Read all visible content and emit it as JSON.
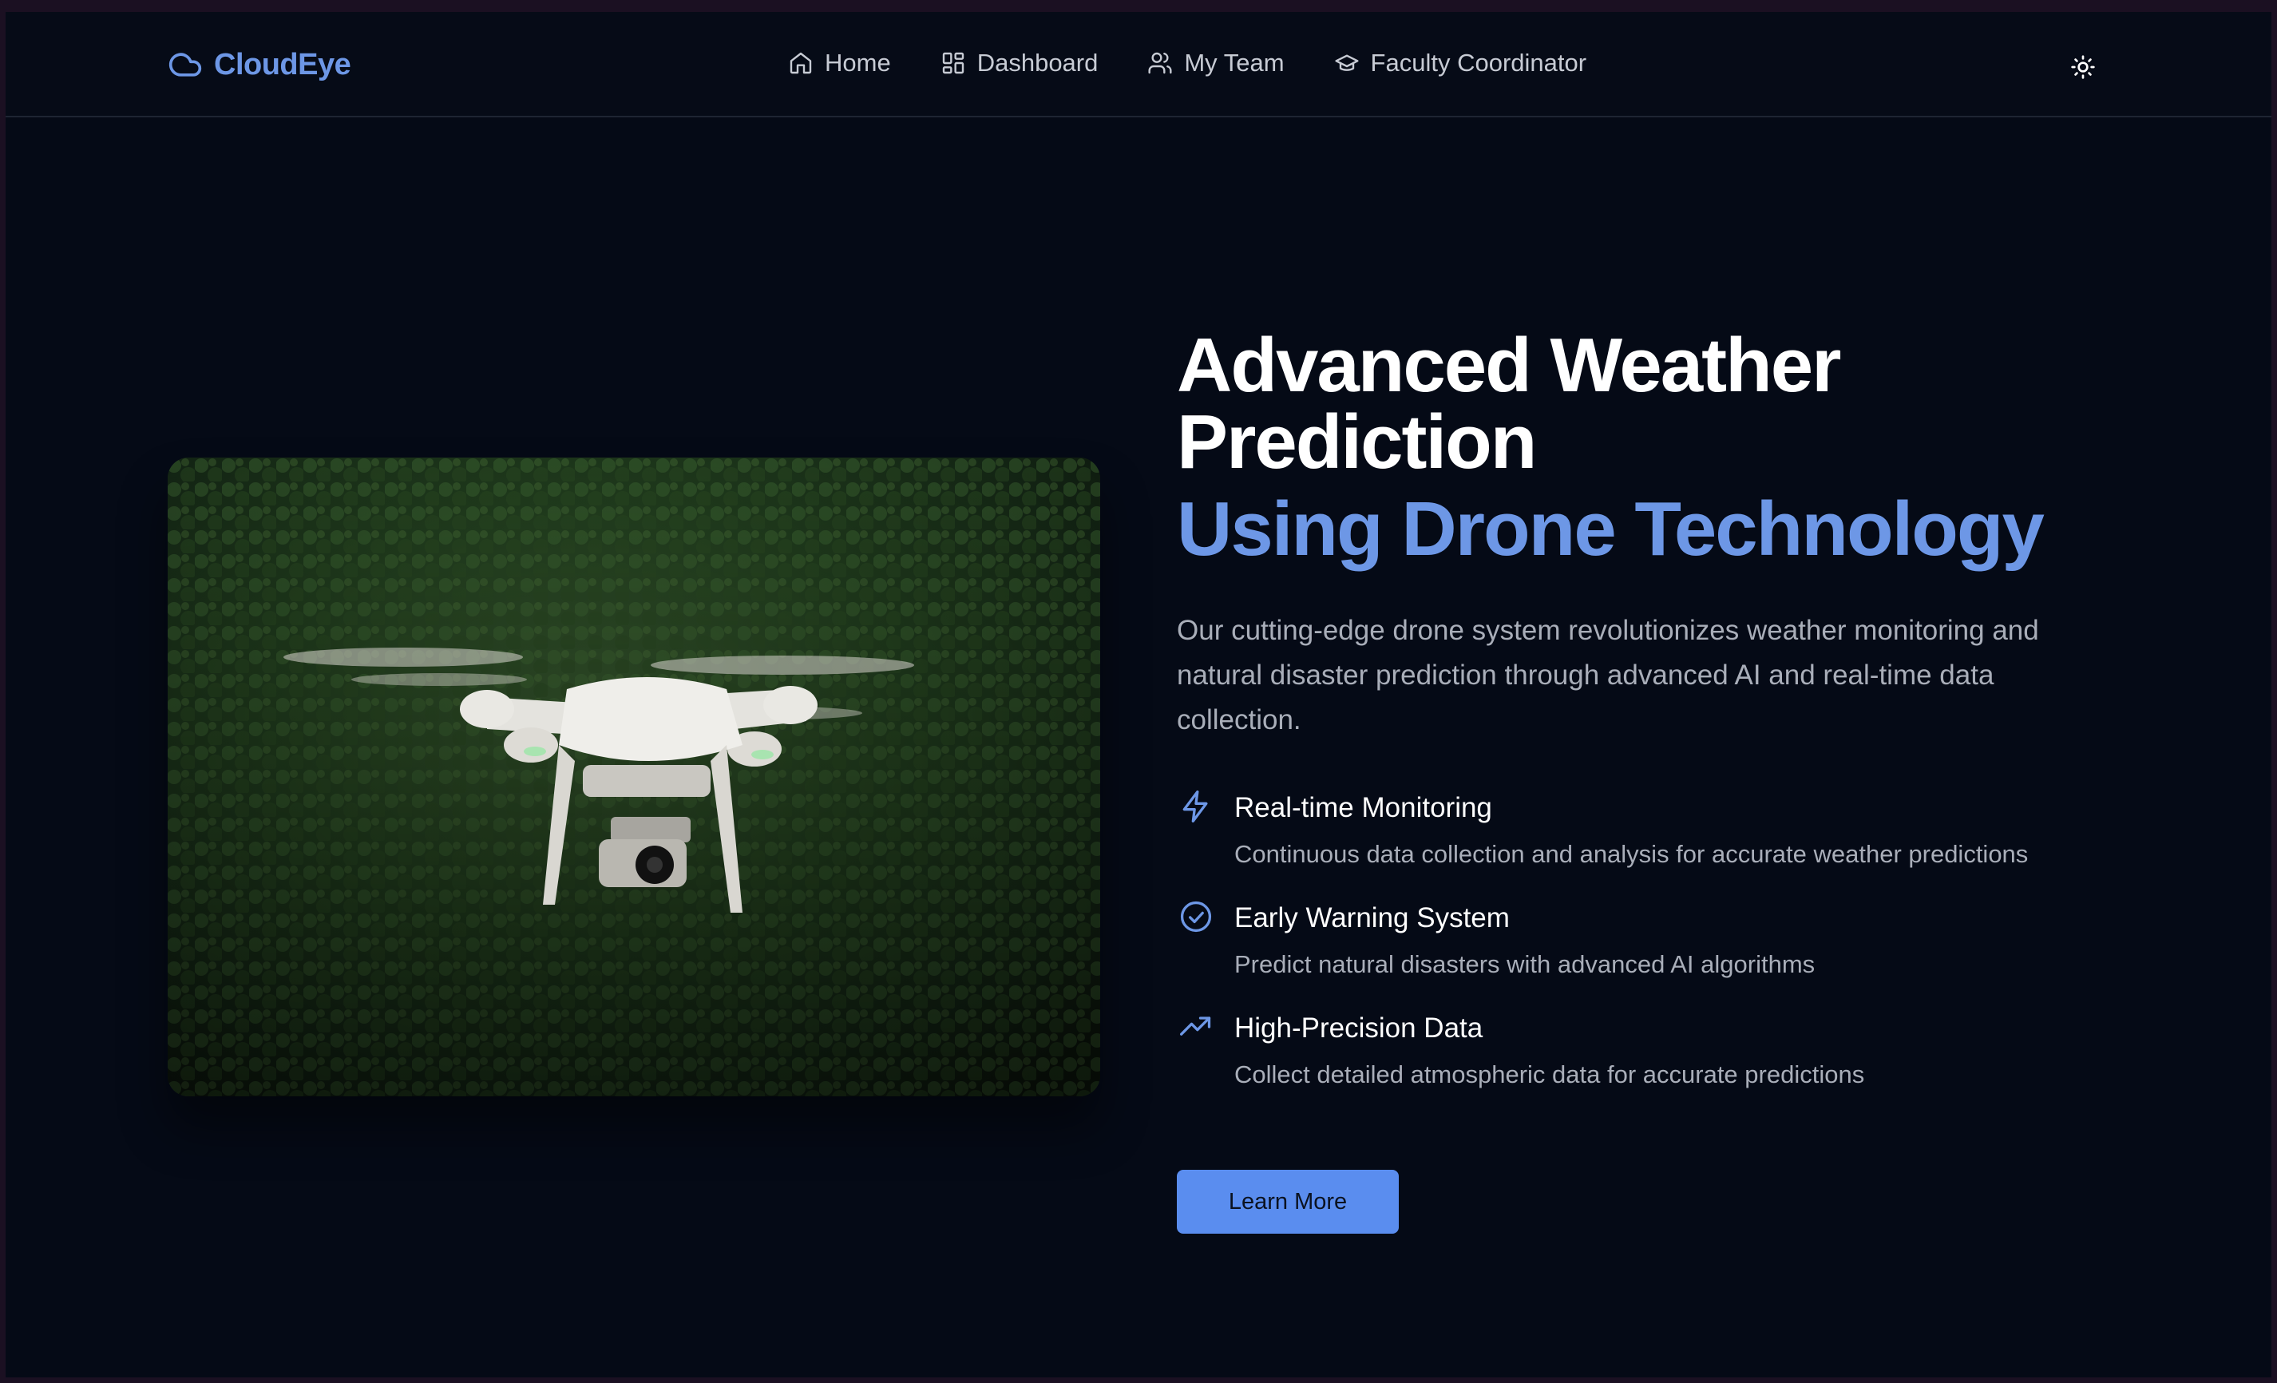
{
  "brand": {
    "name": "CloudEye",
    "icon": "cloud-icon"
  },
  "nav": {
    "items": [
      {
        "label": "Home",
        "icon": "home-icon"
      },
      {
        "label": "Dashboard",
        "icon": "dashboard-grid-icon"
      },
      {
        "label": "My Team",
        "icon": "users-icon"
      },
      {
        "label": "Faculty Coordinator",
        "icon": "graduation-cap-icon"
      }
    ],
    "theme_toggle_icon": "sun-icon"
  },
  "hero": {
    "title": "Advanced Weather Prediction",
    "title_accent": "Using Drone Technology",
    "description": "Our cutting-edge drone system revolutionizes weather monitoring and natural disaster prediction through advanced AI and real-time data collection.",
    "features": [
      {
        "icon": "zap-icon",
        "title": "Real-time Monitoring",
        "description": "Continuous data collection and analysis for accurate weather predictions"
      },
      {
        "icon": "check-circle-icon",
        "title": "Early Warning System",
        "description": "Predict natural disasters with advanced AI algorithms"
      },
      {
        "icon": "trending-up-icon",
        "title": "High-Precision Data",
        "description": "Collect detailed atmospheric data for accurate predictions"
      }
    ],
    "cta_label": "Learn More",
    "image_subject": "drone-over-forest"
  },
  "colors": {
    "background": "#050a16",
    "accent": "#6d97e6",
    "button": "#5a8def",
    "muted_text": "#a9aeb9"
  }
}
